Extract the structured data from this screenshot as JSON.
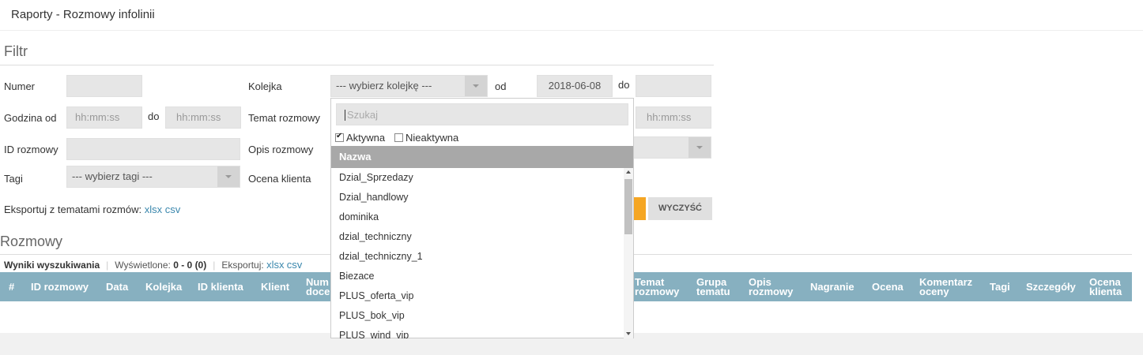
{
  "page": {
    "title": "Raporty - Rozmowy infolinii"
  },
  "filter": {
    "title": "Filtr",
    "numer_label": "Numer",
    "godzina_od_label": "Godzina od",
    "godzina_do_label": "do",
    "time_placeholder": "hh:mm:ss",
    "id_rozmowy_label": "ID rozmowy",
    "tagi_label": "Tagi",
    "tagi_select": "--- wybierz tagi ---",
    "kolejka_label": "Kolejka",
    "kolejka_select": "--- wybierz kolejkę ---",
    "od_label": "od",
    "date_from": "2018-06-08",
    "do_label": "do",
    "temat_label": "Temat rozmowy",
    "opis_label": "Opis rozmowy",
    "ocena_label": "Ocena klienta",
    "export_text": "Eksportuj z tematami rozmów:",
    "export_xlsx": "xlsx",
    "export_csv": "csv",
    "clear_button": "WYCZYŚĆ"
  },
  "dropdown": {
    "search_placeholder": "Szukaj",
    "active_label": "Aktywna",
    "inactive_label": "Nieaktywna",
    "header": "Nazwa",
    "items": [
      "Dzial_Sprzedazy",
      "Dzial_handlowy",
      "dominika",
      "dzial_techniczny",
      "dzial_techniczny_1",
      "Biezace",
      "PLUS_oferta_vip",
      "PLUS_bok_vip",
      "PLUS_wind_vip"
    ]
  },
  "results": {
    "title": "Rozmowy",
    "search_results": "Wyniki wyszukiwania",
    "shown_label": "Wyświetlone:",
    "shown_value": "0 - 0 (0)",
    "export_label": "Eksportuj:",
    "export_xlsx": "xlsx",
    "export_csv": "csv"
  },
  "table": {
    "columns": {
      "hash": "#",
      "id": "ID rozmowy",
      "data": "Data",
      "kolejka": "Kolejka",
      "id_klienta": "ID klienta",
      "klient": "Klient",
      "numer_a": "Num",
      "numer_b": "doce",
      "temat_a": "Temat",
      "temat_b": "rozmowy",
      "grupa_a": "Grupa",
      "grupa_b": "tematu",
      "opis_a": "Opis",
      "opis_b": "rozmowy",
      "nagranie": "Nagranie",
      "ocena": "Ocena",
      "kom_a": "Komentarz",
      "kom_b": "oceny",
      "tagi": "Tagi",
      "szczegoly": "Szczegóły",
      "ock_a": "Ocena",
      "ock_b": "klienta"
    }
  },
  "colors": {
    "accent": "#f5a623",
    "table_header": "#87b0c0",
    "link": "#3a87ad"
  }
}
